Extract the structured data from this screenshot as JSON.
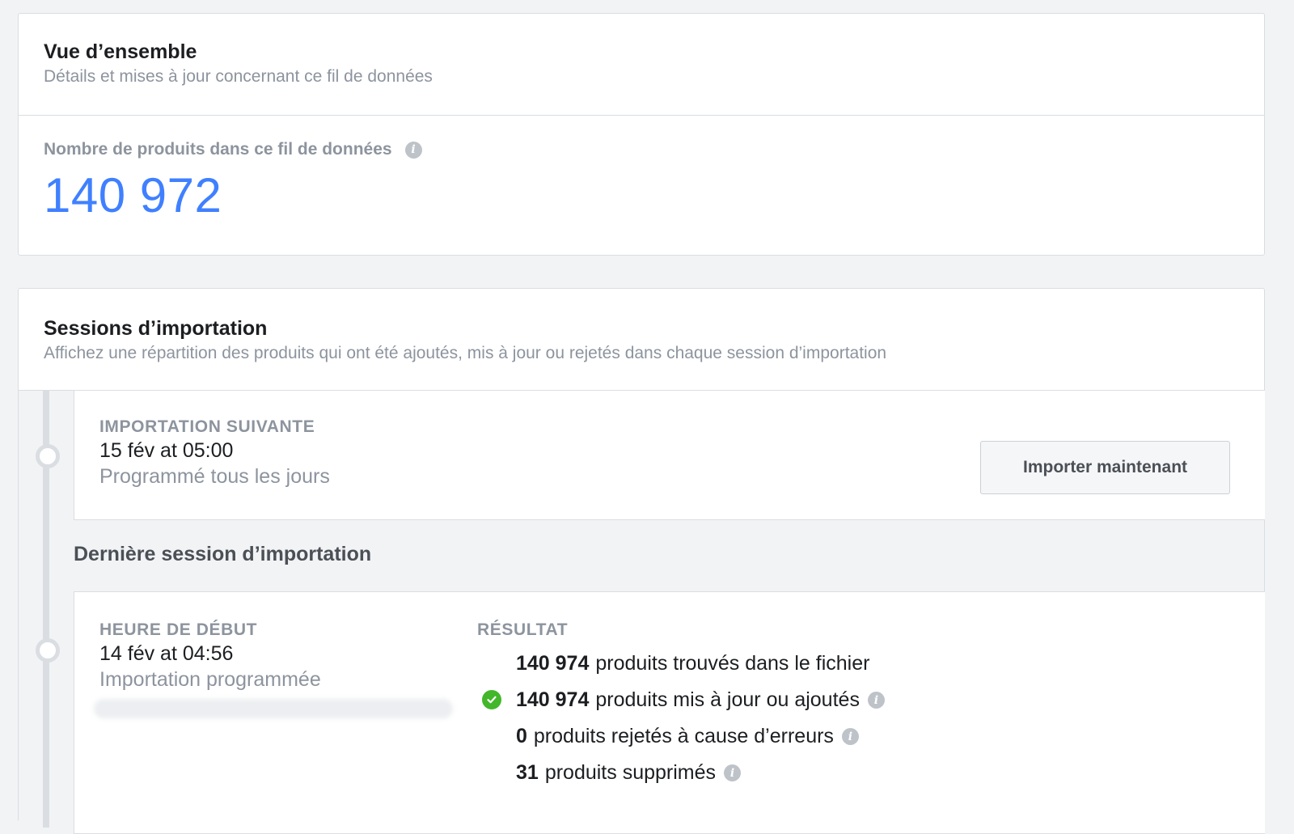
{
  "overview": {
    "title": "Vue d’ensemble",
    "subtitle": "Détails et mises à jour concernant ce fil de données",
    "count_label": "Nombre de produits dans ce fil de données",
    "count_value": "140 972"
  },
  "sessions": {
    "title": "Sessions d’importation",
    "subtitle": "Affichez une répartition des produits qui ont été ajoutés, mis à jour ou rejetés dans chaque session d’importation",
    "next": {
      "label": "IMPORTATION SUIVANTE",
      "datetime": "15 fév at 05:00",
      "schedule": "Programmé tous les jours",
      "button": "Importer maintenant"
    },
    "last_heading": "Dernière session d’importation",
    "last": {
      "start_label": "HEURE DE DÉBUT",
      "start_datetime": "14 fév at 04:56",
      "start_type": "Importation programmée",
      "result_label": "RÉSULTAT",
      "results": [
        {
          "count": "140 974",
          "text": "produits trouvés dans le fichier",
          "status_icon": "",
          "info": false
        },
        {
          "count": "140 974",
          "text": "produits mis à jour ou ajoutés",
          "status_icon": "check-circle",
          "info": true
        },
        {
          "count": "0",
          "text": "produits rejetés à cause d’erreurs",
          "status_icon": "",
          "info": true
        },
        {
          "count": "31",
          "text": "produits supprimés",
          "status_icon": "",
          "info": true
        }
      ]
    }
  },
  "colors": {
    "accent": "#4080ff",
    "success": "#42b72a",
    "muted": "#8d949e"
  }
}
